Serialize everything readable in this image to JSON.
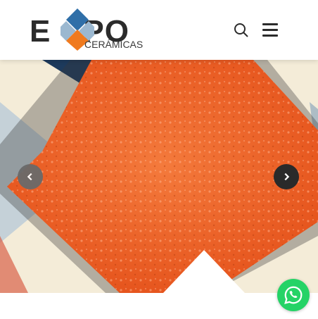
{
  "header": {
    "logo": {
      "main_text": "EXPO",
      "sub_text": "CERÁMICAS"
    },
    "search_icon": "search-icon",
    "menu_icon": "hamburger-menu-icon"
  },
  "hero": {
    "prev_icon": "chevron-left-icon",
    "next_icon": "chevron-right-icon"
  },
  "colors": {
    "orange": "#f0662a",
    "navy": "#1d3a5c",
    "cream": "#f4ecd8",
    "whatsapp": "#25d366"
  },
  "floating": {
    "whatsapp_icon": "whatsapp-icon"
  }
}
